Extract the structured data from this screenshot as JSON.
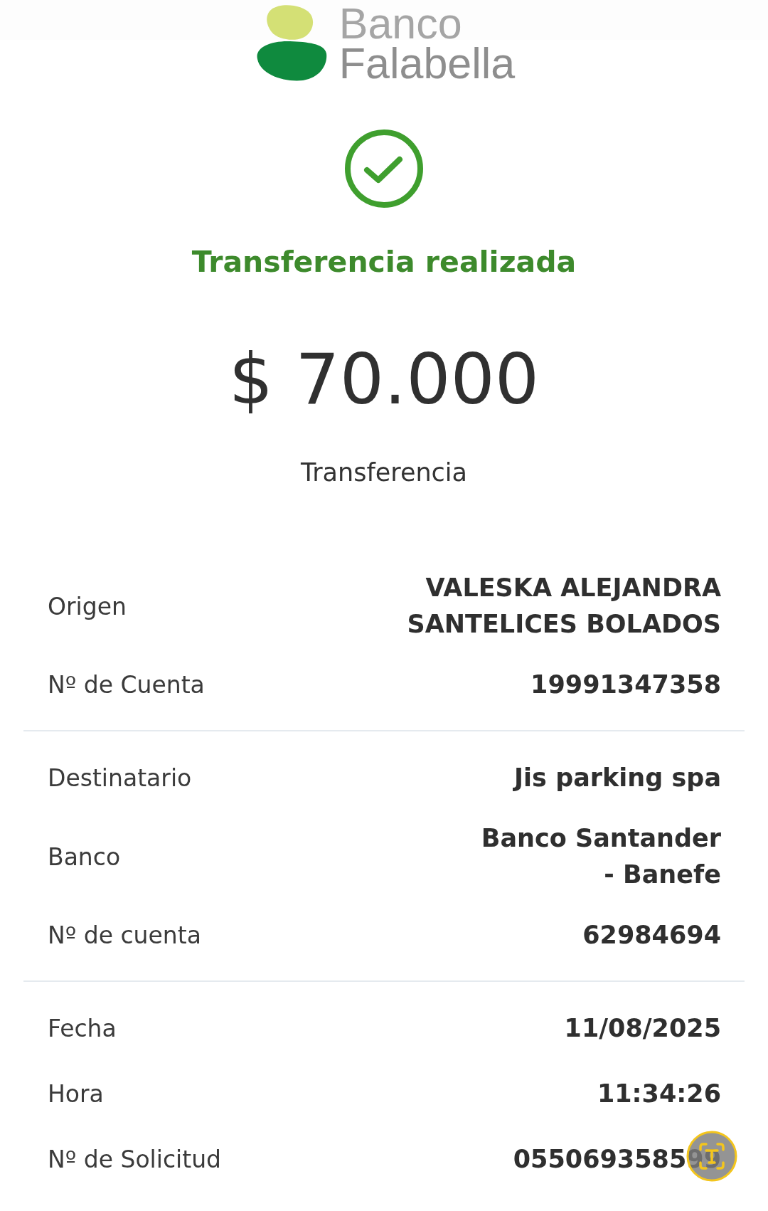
{
  "header": {
    "logo_top": "Banco",
    "logo_bottom": "Falabella"
  },
  "result": {
    "title": "Transferencia realizada",
    "amount": "$ 70.000",
    "type": "Transferencia"
  },
  "sections": [
    {
      "rows": [
        {
          "label": "Origen",
          "value": [
            "VALESKA ALEJANDRA",
            "SANTELICES BOLADOS"
          ]
        },
        {
          "label": "Nº de Cuenta",
          "value": [
            "19991347358"
          ]
        }
      ]
    },
    {
      "rows": [
        {
          "label": "Destinatario",
          "value": [
            "Jis parking spa"
          ]
        },
        {
          "label": "Banco",
          "value": [
            "Banco Santander",
            "- Banefe"
          ]
        },
        {
          "label": "Nº de cuenta",
          "value": [
            "62984694"
          ]
        }
      ]
    },
    {
      "rows": [
        {
          "label": "Fecha",
          "value": [
            "11/08/2025"
          ]
        },
        {
          "label": "Hora",
          "value": [
            "11:34:26"
          ]
        },
        {
          "label": "Nº de Solicitud",
          "value": [
            "055069358599"
          ]
        }
      ]
    }
  ]
}
